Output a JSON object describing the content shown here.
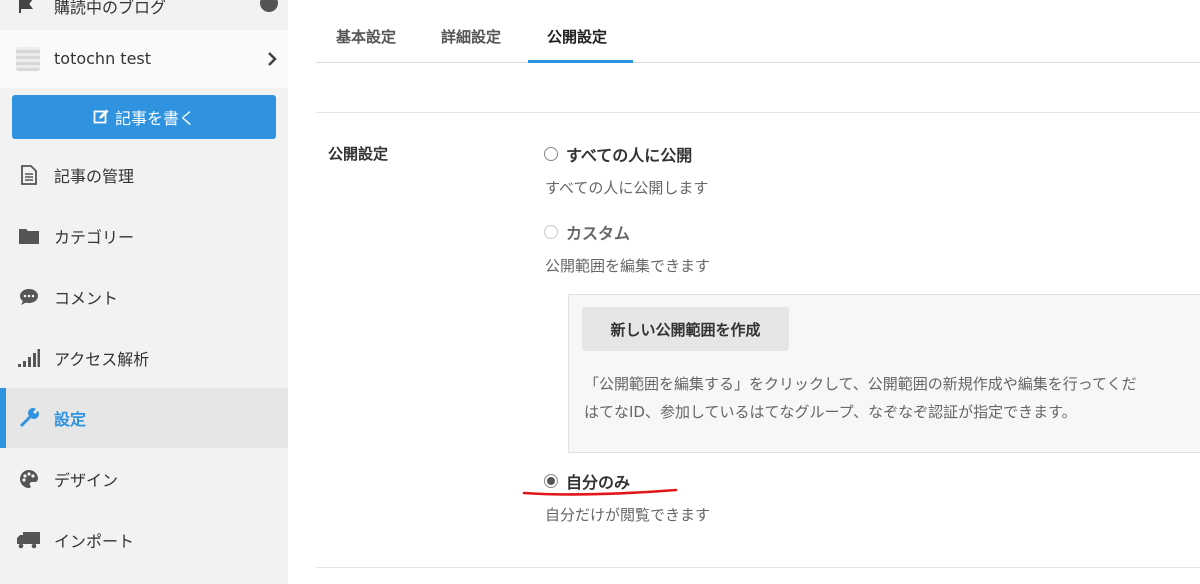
{
  "sidebar": {
    "top_item": {
      "label": "購読中のブログ",
      "icon": "flag-icon"
    },
    "blog": {
      "name": "totochn test",
      "icon": "blog-favicon",
      "chevron": "chevron-right-icon"
    },
    "write_button": {
      "label": "記事を書く",
      "icon": "edit-icon"
    },
    "items": [
      {
        "label": "記事の管理",
        "icon": "document-icon"
      },
      {
        "label": "カテゴリー",
        "icon": "folder-icon"
      },
      {
        "label": "コメント",
        "icon": "comment-icon"
      },
      {
        "label": "アクセス解析",
        "icon": "signal-bars-icon"
      },
      {
        "label": "設定",
        "icon": "wrench-icon",
        "active": true
      },
      {
        "label": "デザイン",
        "icon": "palette-icon"
      },
      {
        "label": "インポート",
        "icon": "truck-icon"
      }
    ],
    "accent_color": "#2f93e0"
  },
  "tabs": [
    {
      "label": "基本設定"
    },
    {
      "label": "詳細設定"
    },
    {
      "label": "公開設定",
      "active": true
    }
  ],
  "visibility": {
    "label": "公開設定",
    "options": [
      {
        "label": "すべての人に公開",
        "description": "すべての人に公開します",
        "checked": false,
        "disabled": false
      },
      {
        "label": "カスタム",
        "description": "公開範囲を編集できます",
        "checked": false,
        "disabled": true
      },
      {
        "label": "自分のみ",
        "description": "自分だけが閲覧できます",
        "checked": true,
        "disabled": false
      }
    ],
    "custom_box": {
      "button_label": "新しい公開範囲を作成",
      "help_line1": "「公開範囲を編集する」をクリックして、公開範囲の新規作成や編集を行ってくだ",
      "help_line2": "はてなID、参加しているはてなグループ、なぞなぞ認証が指定できます。"
    },
    "annotation_color": "#e0161b"
  }
}
